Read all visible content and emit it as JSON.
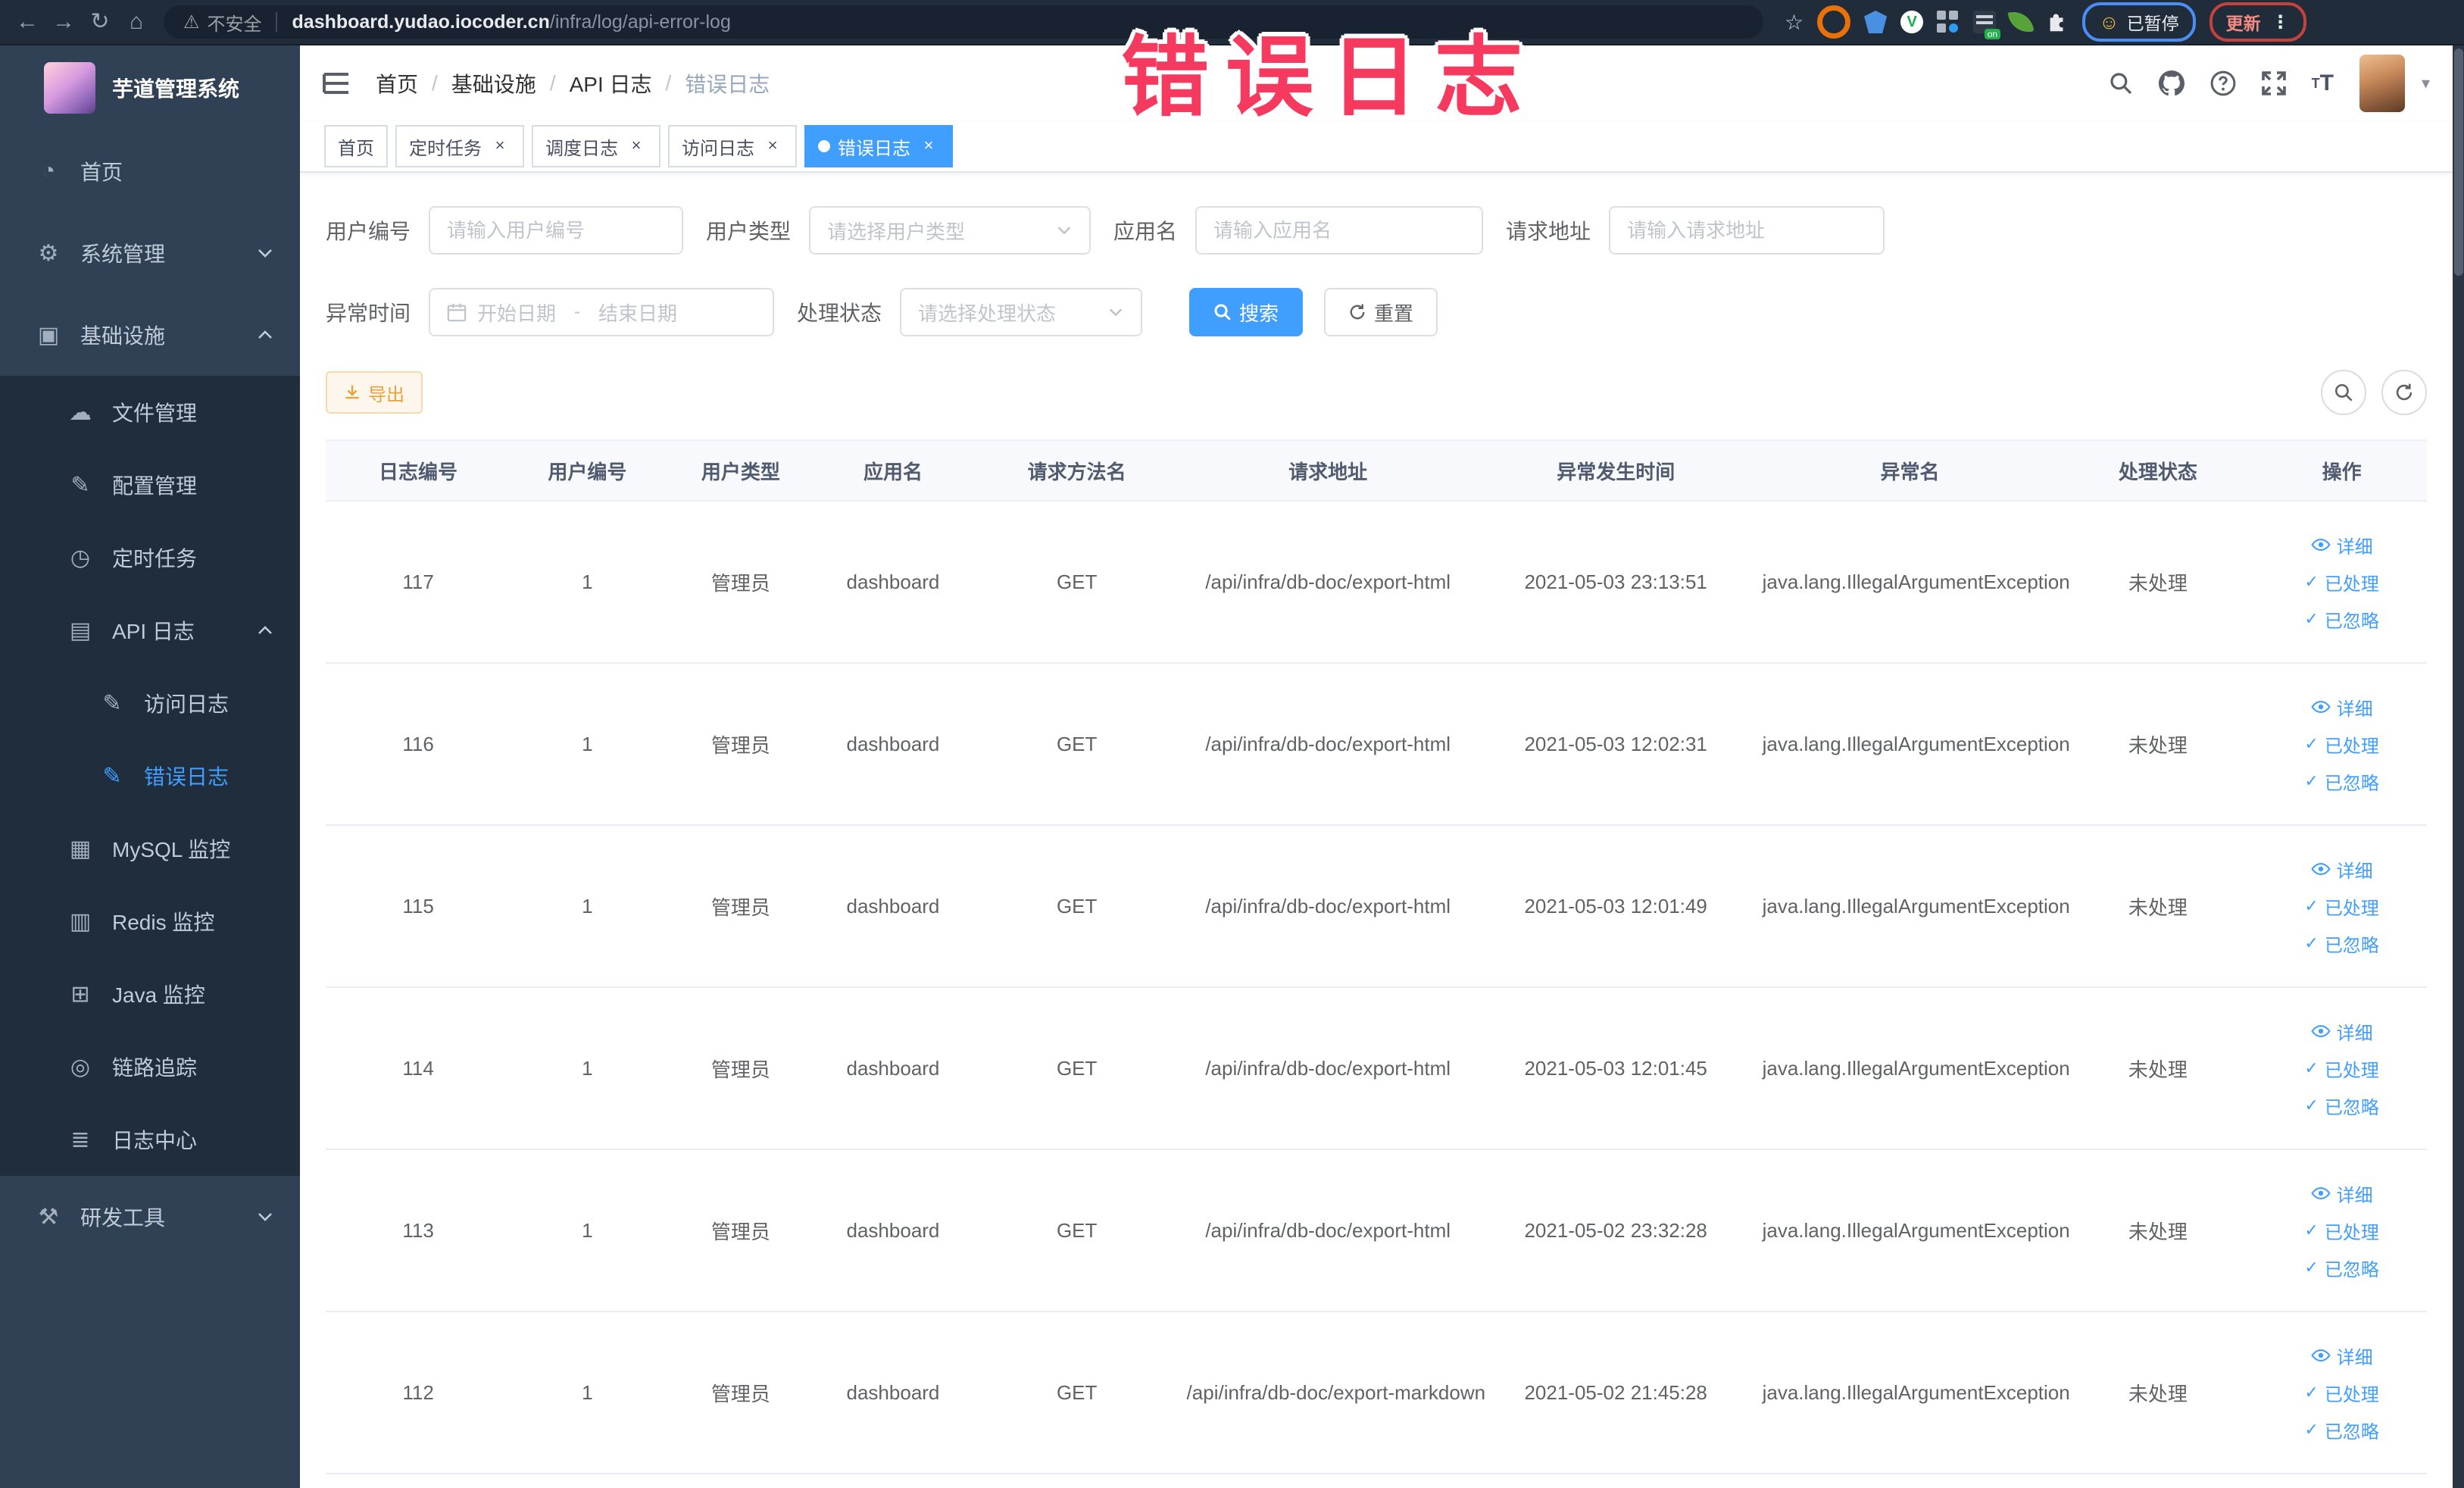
{
  "browser": {
    "security_label": "不安全",
    "url_host": "dashboard.yudao.iocoder.cn",
    "url_path": "/infra/log/api-error-log",
    "paused_label": "已暂停",
    "update_label": "更新"
  },
  "annotation": {
    "text": "错误日志",
    "color": "#f5395f"
  },
  "sidebar": {
    "title": "芋道管理系统",
    "items": [
      {
        "id": "home",
        "label": "首页",
        "icon": "dashboard-icon",
        "indent": 0,
        "dark": false
      },
      {
        "id": "system-management",
        "label": "系统管理",
        "icon": "gear-icon",
        "indent": 0,
        "dark": false,
        "chevron": "down"
      },
      {
        "id": "infrastructure",
        "label": "基础设施",
        "icon": "infrastructure-icon",
        "indent": 0,
        "dark": false,
        "chevron": "up"
      },
      {
        "id": "file-management",
        "label": "文件管理",
        "icon": "cloud-icon",
        "indent": 1,
        "dark": true
      },
      {
        "id": "config-management",
        "label": "配置管理",
        "icon": "edit-icon",
        "indent": 1,
        "dark": true
      },
      {
        "id": "scheduled-tasks",
        "label": "定时任务",
        "icon": "clock-icon",
        "indent": 1,
        "dark": true
      },
      {
        "id": "api-log",
        "label": "API 日志",
        "icon": "api-log-icon",
        "indent": 1,
        "dark": true,
        "chevron": "up"
      },
      {
        "id": "access-log",
        "label": "访问日志",
        "icon": "access-log-icon",
        "indent": 2,
        "dark": true
      },
      {
        "id": "error-log",
        "label": "错误日志",
        "icon": "error-log-icon",
        "indent": 2,
        "dark": true,
        "active": true
      },
      {
        "id": "mysql-monitor",
        "label": "MySQL 监控",
        "icon": "mysql-icon",
        "indent": 1,
        "dark": true
      },
      {
        "id": "redis-monitor",
        "label": "Redis 监控",
        "icon": "redis-icon",
        "indent": 1,
        "dark": true
      },
      {
        "id": "java-monitor",
        "label": "Java 监控",
        "icon": "java-icon",
        "indent": 1,
        "dark": true
      },
      {
        "id": "trace",
        "label": "链路追踪",
        "icon": "trace-icon",
        "indent": 1,
        "dark": true
      },
      {
        "id": "log-center",
        "label": "日志中心",
        "icon": "log-center-icon",
        "indent": 1,
        "dark": true
      },
      {
        "id": "dev-tools",
        "label": "研发工具",
        "icon": "tools-icon",
        "indent": 0,
        "dark": false,
        "chevron": "down"
      }
    ]
  },
  "breadcrumb": [
    "首页",
    "基础设施",
    "API 日志",
    "错误日志"
  ],
  "tags": [
    {
      "label": "首页",
      "closable": false,
      "active": false
    },
    {
      "label": "定时任务",
      "closable": true,
      "active": false
    },
    {
      "label": "调度日志",
      "closable": true,
      "active": false
    },
    {
      "label": "访问日志",
      "closable": true,
      "active": false
    },
    {
      "label": "错误日志",
      "closable": true,
      "active": true
    }
  ],
  "filters": {
    "user_id": {
      "label": "用户编号",
      "placeholder": "请输入用户编号"
    },
    "user_type": {
      "label": "用户类型",
      "placeholder": "请选择用户类型"
    },
    "app_name": {
      "label": "应用名",
      "placeholder": "请输入应用名"
    },
    "request_url": {
      "label": "请求地址",
      "placeholder": "请输入请求地址"
    },
    "exception_time": {
      "label": "异常时间",
      "start_placeholder": "开始日期",
      "separator": "-",
      "end_placeholder": "结束日期"
    },
    "process_status": {
      "label": "处理状态",
      "placeholder": "请选择处理状态"
    },
    "search_label": "搜索",
    "reset_label": "重置"
  },
  "toolbar": {
    "export_label": "导出"
  },
  "table": {
    "columns": [
      "日志编号",
      "用户编号",
      "用户类型",
      "应用名",
      "请求方法名",
      "请求地址",
      "异常发生时间",
      "异常名",
      "处理状态",
      "操作"
    ],
    "row_actions": [
      "详细",
      "已处理",
      "已忽略"
    ],
    "rows": [
      {
        "id": "117",
        "user_id": "1",
        "user_type": "管理员",
        "app": "dashboard",
        "method": "GET",
        "url": "/api/infra/db-doc/export-html",
        "time": "2021-05-03 23:13:51",
        "exception": "java.lang.IllegalArgumentException",
        "status": "未处理"
      },
      {
        "id": "116",
        "user_id": "1",
        "user_type": "管理员",
        "app": "dashboard",
        "method": "GET",
        "url": "/api/infra/db-doc/export-html",
        "time": "2021-05-03 12:02:31",
        "exception": "java.lang.IllegalArgumentException",
        "status": "未处理"
      },
      {
        "id": "115",
        "user_id": "1",
        "user_type": "管理员",
        "app": "dashboard",
        "method": "GET",
        "url": "/api/infra/db-doc/export-html",
        "time": "2021-05-03 12:01:49",
        "exception": "java.lang.IllegalArgumentException",
        "status": "未处理"
      },
      {
        "id": "114",
        "user_id": "1",
        "user_type": "管理员",
        "app": "dashboard",
        "method": "GET",
        "url": "/api/infra/db-doc/export-html",
        "time": "2021-05-03 12:01:45",
        "exception": "java.lang.IllegalArgumentException",
        "status": "未处理"
      },
      {
        "id": "113",
        "user_id": "1",
        "user_type": "管理员",
        "app": "dashboard",
        "method": "GET",
        "url": "/api/infra/db-doc/export-html",
        "time": "2021-05-02 23:32:28",
        "exception": "java.lang.IllegalArgumentException",
        "status": "未处理"
      },
      {
        "id": "112",
        "user_id": "1",
        "user_type": "管理员",
        "app": "dashboard",
        "method": "GET",
        "url": "/api/infra/db-doc/export-markdown",
        "time": "2021-05-02 21:45:28",
        "exception": "java.lang.IllegalArgumentException",
        "status": "未处理"
      }
    ]
  }
}
